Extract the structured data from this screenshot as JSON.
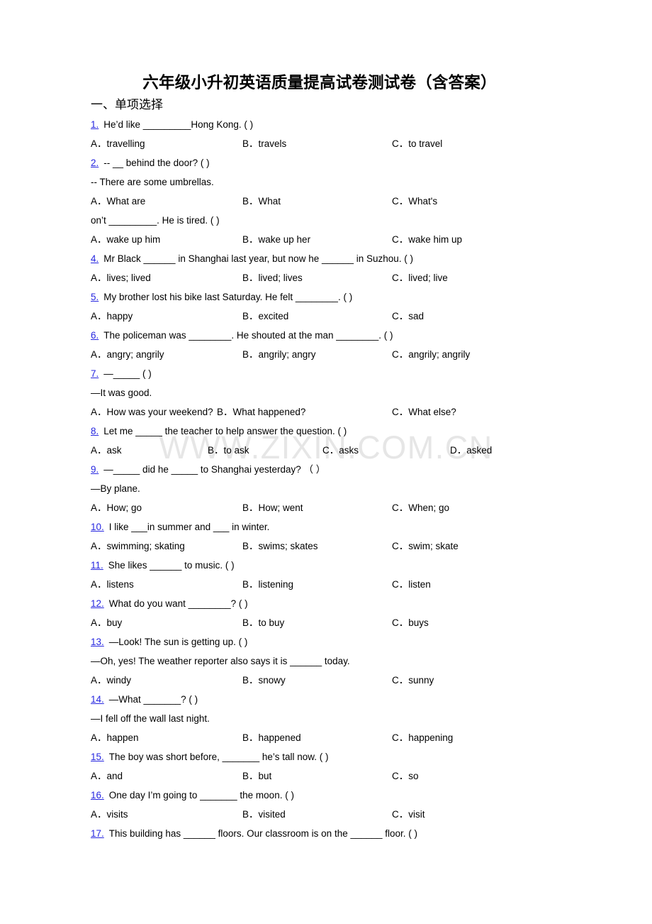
{
  "document": {
    "title": "六年级小升初英语质量提高试卷测试卷（含答案）",
    "section_heading": "一、单项选择",
    "watermark": "WWW.ZIXIN.COM.CN",
    "accent_color": "#2727e0",
    "watermark_color": "#e6e6e6"
  },
  "questions": [
    {
      "number": "1.",
      "stem": "He’d like _________Hong Kong. (  )",
      "reply": null,
      "layout": "cols3",
      "options": [
        {
          "label": "A．",
          "text": "travelling"
        },
        {
          "label": "B．",
          "text": "travels"
        },
        {
          "label": "C．",
          "text": "to travel"
        }
      ]
    },
    {
      "number": "2.",
      "stem": "-- __ behind the door?  (  )",
      "reply": "-- There are some umbrellas.",
      "layout": "cols3",
      "options": [
        {
          "label": "A．",
          "text": "What are"
        },
        {
          "label": "B．",
          "text": "What"
        },
        {
          "label": "C．",
          "text": "What's"
        }
      ]
    },
    {
      "number": "",
      "stem": "on’t _________. He is tired. (  )",
      "reply": null,
      "layout": "cols3",
      "options": [
        {
          "label": "A．",
          "text": "wake up him"
        },
        {
          "label": "B．",
          "text": "wake up her"
        },
        {
          "label": "C．",
          "text": "wake him up"
        }
      ]
    },
    {
      "number": "4.",
      "stem": "Mr Black ______ in Shanghai last year, but now he ______ in Suzhou. (  )",
      "reply": null,
      "layout": "cols3",
      "options": [
        {
          "label": "A．",
          "text": "lives; lived"
        },
        {
          "label": "B．",
          "text": "lived; lives"
        },
        {
          "label": "C．",
          "text": "lived; live"
        }
      ]
    },
    {
      "number": "5.",
      "stem": "My brother lost his bike last Saturday. He felt ________. (  )",
      "reply": null,
      "layout": "cols3",
      "options": [
        {
          "label": "A．",
          "text": "happy"
        },
        {
          "label": "B．",
          "text": "excited"
        },
        {
          "label": "C．",
          "text": "sad"
        }
      ]
    },
    {
      "number": "6.",
      "stem": "The policeman was ________. He shouted at the man ________. (  )",
      "reply": null,
      "layout": "cols3",
      "options": [
        {
          "label": "A．",
          "text": "angry; angrily"
        },
        {
          "label": "B．",
          "text": "angrily; angry"
        },
        {
          "label": "C．",
          "text": "angrily; angrily"
        }
      ]
    },
    {
      "number": "7.",
      "stem": "—_____ (  )",
      "reply": "—It was good.",
      "layout": "narrow",
      "options": [
        {
          "label": "A．",
          "text": "How was your weekend?"
        },
        {
          "label": "B．",
          "text": "What happened?"
        },
        {
          "label": "C．",
          "text": "What else?"
        }
      ]
    },
    {
      "number": "8.",
      "stem": "Let me _____ the teacher to help answer the question. (  )",
      "reply": null,
      "layout": "cols4",
      "options": [
        {
          "label": "A．",
          "text": "ask"
        },
        {
          "label": "B．",
          "text": "to ask"
        },
        {
          "label": "C．",
          "text": "asks"
        },
        {
          "label": "D．",
          "text": "asked"
        }
      ]
    },
    {
      "number": "9.",
      "stem": "—_____ did he _____ to Shanghai yesterday?  （    ）",
      "reply": "—By plane.",
      "layout": "cols3",
      "options": [
        {
          "label": "A．",
          "text": "How; go"
        },
        {
          "label": "B．",
          "text": "How; went"
        },
        {
          "label": "C．",
          "text": "When; go"
        }
      ]
    },
    {
      "number": "10.",
      "stem": "I like ___in summer and ___ in winter.",
      "reply": null,
      "layout": "cols3",
      "options": [
        {
          "label": "A．",
          "text": "swimming; skating"
        },
        {
          "label": "B．",
          "text": "swims; skates"
        },
        {
          "label": "C．",
          "text": "swim; skate"
        }
      ]
    },
    {
      "number": "11.",
      "stem": "She likes ______ to music. (  )",
      "reply": null,
      "layout": "cols3",
      "options": [
        {
          "label": "A．",
          "text": "listens"
        },
        {
          "label": "B．",
          "text": "listening"
        },
        {
          "label": "C．",
          "text": "listen"
        }
      ]
    },
    {
      "number": "12.",
      "stem": "What do you want ________? (  )",
      "reply": null,
      "layout": "cols3",
      "options": [
        {
          "label": "A．",
          "text": "buy"
        },
        {
          "label": "B．",
          "text": "to buy"
        },
        {
          "label": "C．",
          "text": "buys"
        }
      ]
    },
    {
      "number": "13.",
      "stem": "—Look! The sun is getting up. (  )",
      "reply": "—Oh, yes! The weather reporter also says it is ______ today.",
      "layout": "cols3",
      "options": [
        {
          "label": "A．",
          "text": "windy"
        },
        {
          "label": "B．",
          "text": "snowy"
        },
        {
          "label": "C．",
          "text": "sunny"
        }
      ]
    },
    {
      "number": "14.",
      "stem": "—What _______? (  )",
      "reply": "—I fell off the wall last night.",
      "layout": "cols3",
      "options": [
        {
          "label": "A．",
          "text": "happen"
        },
        {
          "label": "B．",
          "text": "happened"
        },
        {
          "label": "C．",
          "text": "happening"
        }
      ]
    },
    {
      "number": "15.",
      "stem": "The boy was short before, _______ he’s tall now. (  )",
      "reply": null,
      "layout": "cols3",
      "options": [
        {
          "label": "A．",
          "text": "and"
        },
        {
          "label": "B．",
          "text": "but"
        },
        {
          "label": "C．",
          "text": "so"
        }
      ]
    },
    {
      "number": "16.",
      "stem": "One day I’m going to _______ the moon. (  )",
      "reply": null,
      "layout": "cols3",
      "options": [
        {
          "label": "A．",
          "text": "visits"
        },
        {
          "label": "B．",
          "text": "visited"
        },
        {
          "label": "C．",
          "text": "visit"
        }
      ]
    },
    {
      "number": "17.",
      "stem": "This building has ______ floors. Our classroom is on the ______ floor. (  )",
      "reply": null,
      "layout": "cols3",
      "options": []
    }
  ]
}
